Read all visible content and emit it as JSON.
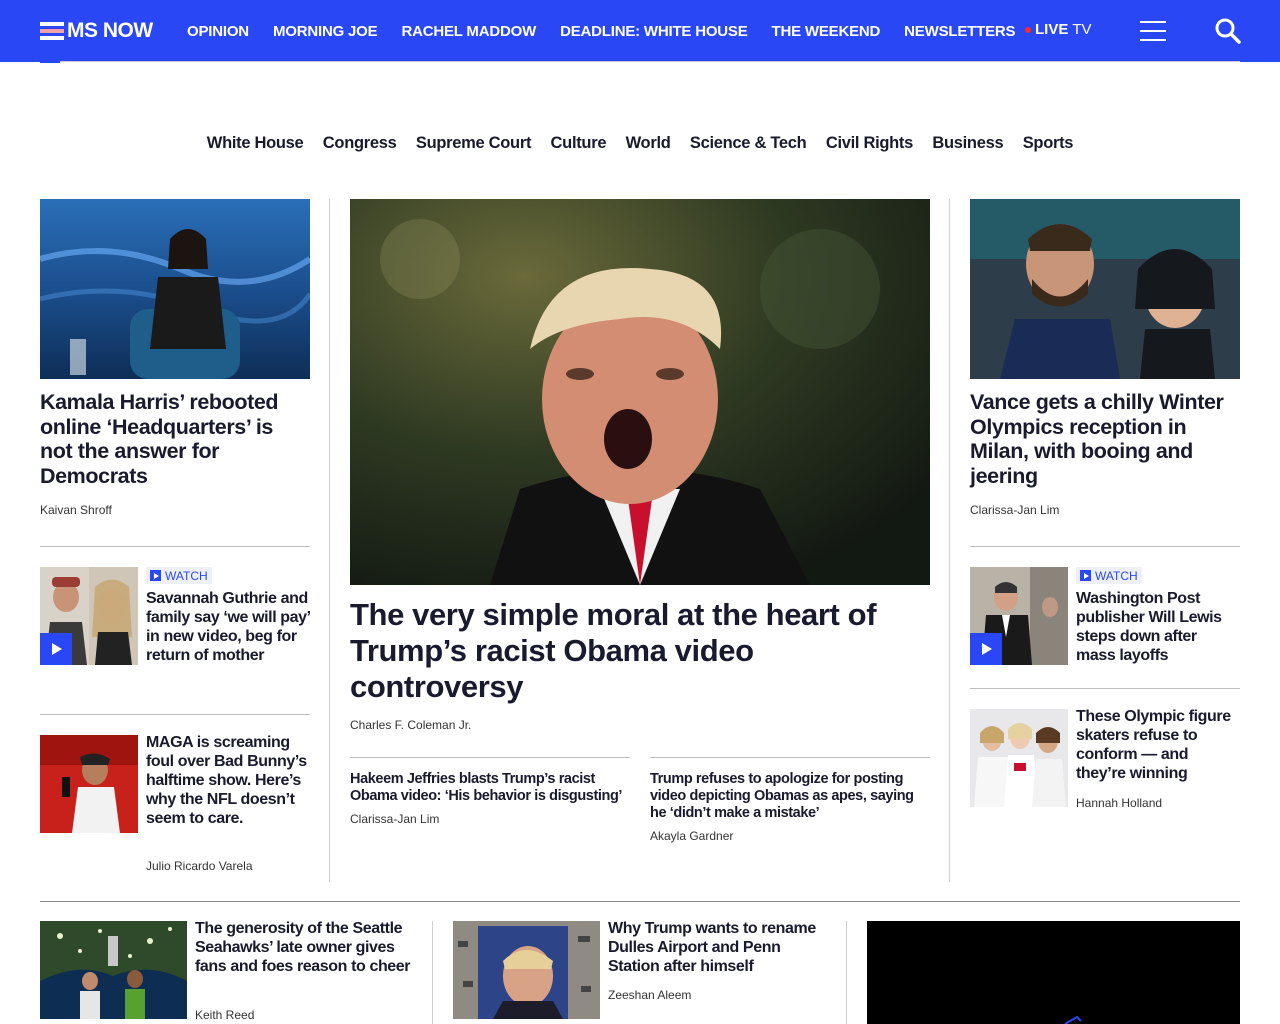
{
  "brand": {
    "name": "MS NOW",
    "accent": "#2a47f5"
  },
  "topnav": [
    "OPINION",
    "MORNING JOE",
    "RACHEL MADDOW",
    "DEADLINE: WHITE HOUSE",
    "THE WEEKEND",
    "NEWSLETTERS"
  ],
  "live": {
    "live": "LIVE",
    "tv": "TV"
  },
  "icons": {
    "menu": "hamburger-menu-icon",
    "search": "search-icon",
    "play": "play-icon"
  },
  "sections": [
    "White House",
    "Congress",
    "Supreme Court",
    "Culture",
    "World",
    "Science & Tech",
    "Civil Rights",
    "Business",
    "Sports"
  ],
  "left": {
    "lead": {
      "headline": "Kamala Harris’ rebooted online ‘Headquarters’ is not the answer for Democrats",
      "byline": "Kaivan Shroff"
    },
    "items": [
      {
        "badge": "WATCH",
        "headline": "Savannah Guthrie and family say ‘we will pay’ in new video, beg for return of mother"
      },
      {
        "headline": "MAGA is screaming foul over Bad Bunny’s halftime show. Here’s why the NFL doesn’t seem to care.",
        "byline": "Julio Ricardo Varela"
      }
    ]
  },
  "center": {
    "lead": {
      "headline": "The very simple moral at the heart of Trump’s racist Obama video controversy",
      "byline": "Charles F. Coleman Jr."
    },
    "related": [
      {
        "headline": "Hakeem Jeffries blasts Trump’s racist Obama video: ‘His behavior is disgusting’",
        "byline": "Clarissa-Jan Lim"
      },
      {
        "headline": "Trump refuses to apologize for posting video depicting Obamas as apes, saying he ‘didn’t make a mistake’",
        "byline": "Akayla Gardner"
      }
    ]
  },
  "right": {
    "lead": {
      "headline": "Vance gets a chilly Winter Olympics reception in Milan, with booing and jeering",
      "byline": "Clarissa-Jan Lim"
    },
    "items": [
      {
        "badge": "WATCH",
        "headline": "Washington Post publisher Will Lewis steps down after mass layoffs"
      },
      {
        "headline": "These Olympic figure skaters refuse to conform — and they’re winning",
        "byline": "Hannah Holland"
      }
    ]
  },
  "bottom": [
    {
      "headline": "The generosity of the Seattle Seahawks’ late owner gives fans and foes reason to cheer",
      "byline": "Keith Reed"
    },
    {
      "headline": "Why Trump wants to rename Dulles Airport and Penn Station after himself",
      "byline": "Zeeshan Aleem"
    }
  ]
}
